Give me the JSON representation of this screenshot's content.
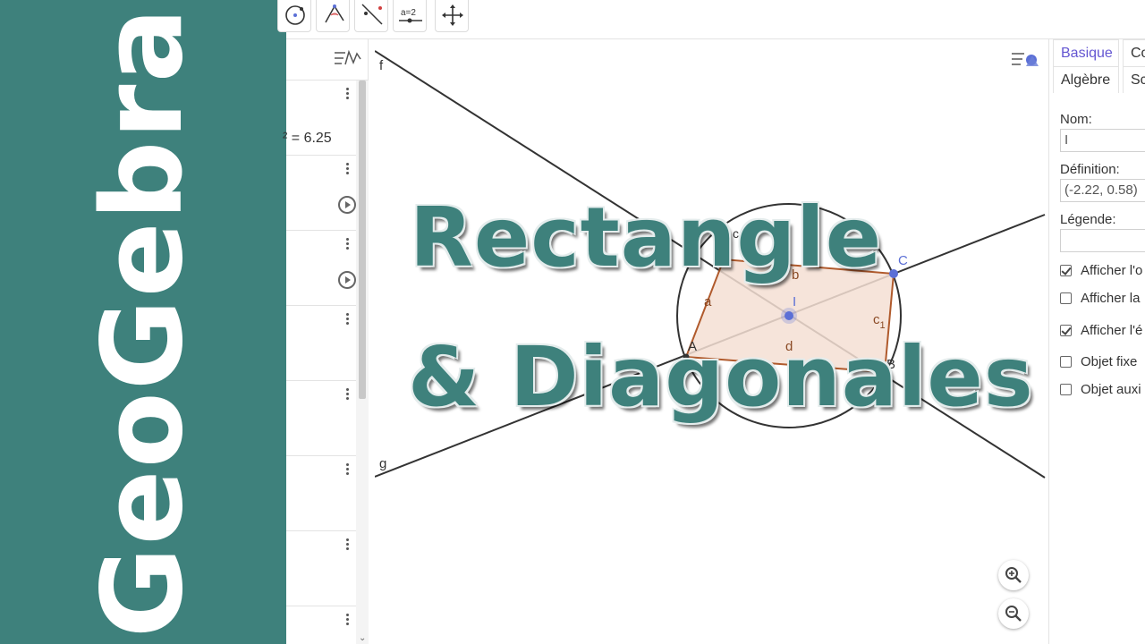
{
  "brand": {
    "vertical_text": "GeoGebra",
    "band_color": "#3e817c"
  },
  "overlay_title": {
    "line1": "Rectangle",
    "line2": "& Diagonales",
    "color": "#3e817c"
  },
  "toolbar": {
    "tools": [
      {
        "name": "circle-tool-icon"
      },
      {
        "name": "angle-tool-icon"
      },
      {
        "name": "line-tool-icon"
      },
      {
        "name": "slider-tool-icon",
        "label": "a=2"
      },
      {
        "name": "move-graphics-tool-icon"
      }
    ]
  },
  "algebra_view": {
    "value_text": "² = 6.25",
    "row_count": 8
  },
  "graphics_view": {
    "line_labels": {
      "f": "f",
      "g": "g"
    },
    "point_labels": {
      "A": "A",
      "B": "B",
      "C": "C",
      "I": "I"
    },
    "segment_labels": {
      "a": "a",
      "b": "b",
      "c": "c",
      "c1_main": "c",
      "c1_sub": "1",
      "d": "d"
    },
    "colors": {
      "polygon_fill": "#f5dfd3",
      "polygon_stroke": "#b05a2c",
      "point": "#5b6fd6",
      "line": "#333333"
    }
  },
  "properties": {
    "tabs_row1": [
      "Basique",
      "Co"
    ],
    "tabs_row2": [
      "Algèbre",
      "Sc"
    ],
    "name_label": "Nom:",
    "name_value": "I",
    "definition_label": "Définition:",
    "definition_value": "(-2.22, 0.58)",
    "caption_label": "Légende:",
    "caption_value": "",
    "checkboxes": [
      {
        "label": "Afficher l'o",
        "checked": true
      },
      {
        "label": "Afficher la",
        "checked": false
      },
      {
        "label": "Afficher l'é",
        "checked": true
      },
      {
        "label": "Objet fixe",
        "checked": false
      },
      {
        "label": "Objet auxi",
        "checked": false
      }
    ]
  }
}
